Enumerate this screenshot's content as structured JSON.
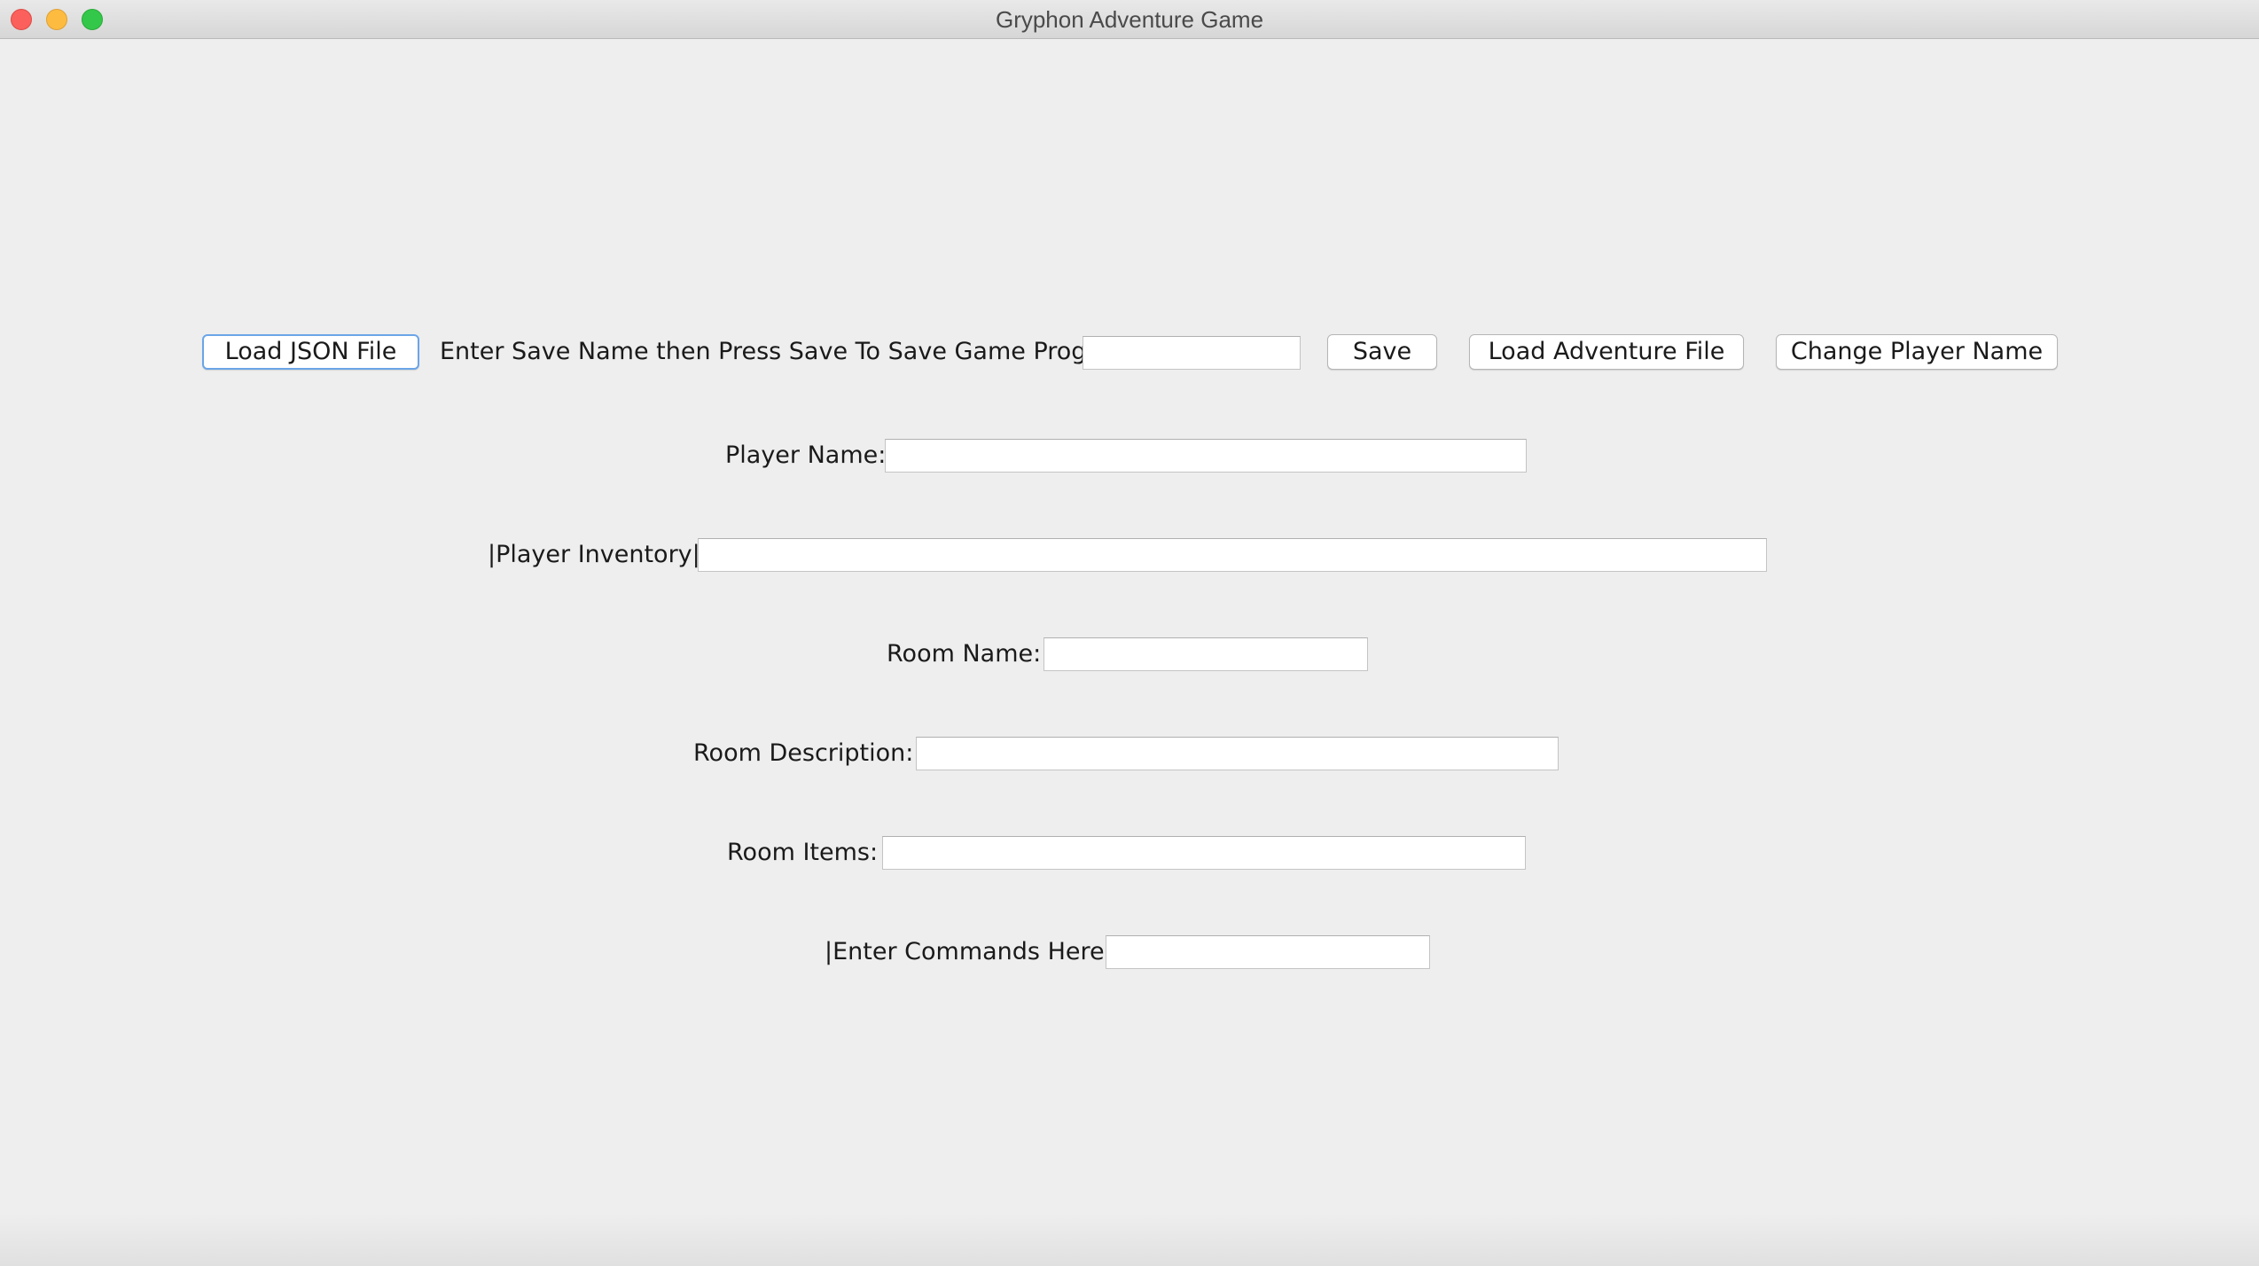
{
  "window": {
    "title": "Gryphon Adventure Game"
  },
  "toolbar": {
    "load_json_label": "Load JSON File",
    "save_instructions": "Enter Save Name then Press Save To Save Game Progress",
    "save_name_value": "",
    "save_label": "Save",
    "load_adventure_label": "Load Adventure File",
    "change_player_name_label": "Change Player Name"
  },
  "form": {
    "player_name_label": "Player Name:",
    "player_name_value": "",
    "player_inventory_label": "|Player Inventory|",
    "player_inventory_value": "",
    "room_name_label": "Room Name:",
    "room_name_value": "",
    "room_description_label": "Room Description:",
    "room_description_value": "",
    "room_items_label": "Room Items:",
    "room_items_value": "",
    "commands_label": "|Enter Commands Here|",
    "commands_value": ""
  },
  "colors": {
    "background": "#eeeeee",
    "focus_ring": "#6aa5e8",
    "close": "#fc605c",
    "minimize": "#fdbc40",
    "maximize": "#34c84a"
  }
}
